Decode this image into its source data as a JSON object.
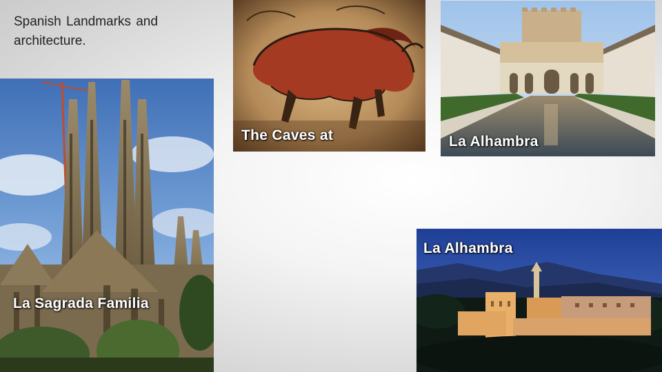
{
  "slide": {
    "title": "Spanish Landmarks and architecture."
  },
  "photos": [
    {
      "caption": "La Sagrada Familia",
      "subject": "basilica-photo"
    },
    {
      "caption": "The Caves at",
      "subject": "cave-painting-photo"
    },
    {
      "caption": "La Alhambra",
      "subject": "courtyard-photo"
    },
    {
      "caption": "La Alhambra",
      "subject": "night-palace-photo"
    }
  ],
  "colors": {
    "caption_text": "#ffffff",
    "title_text": "#222222",
    "background": "#f4f4f4"
  }
}
